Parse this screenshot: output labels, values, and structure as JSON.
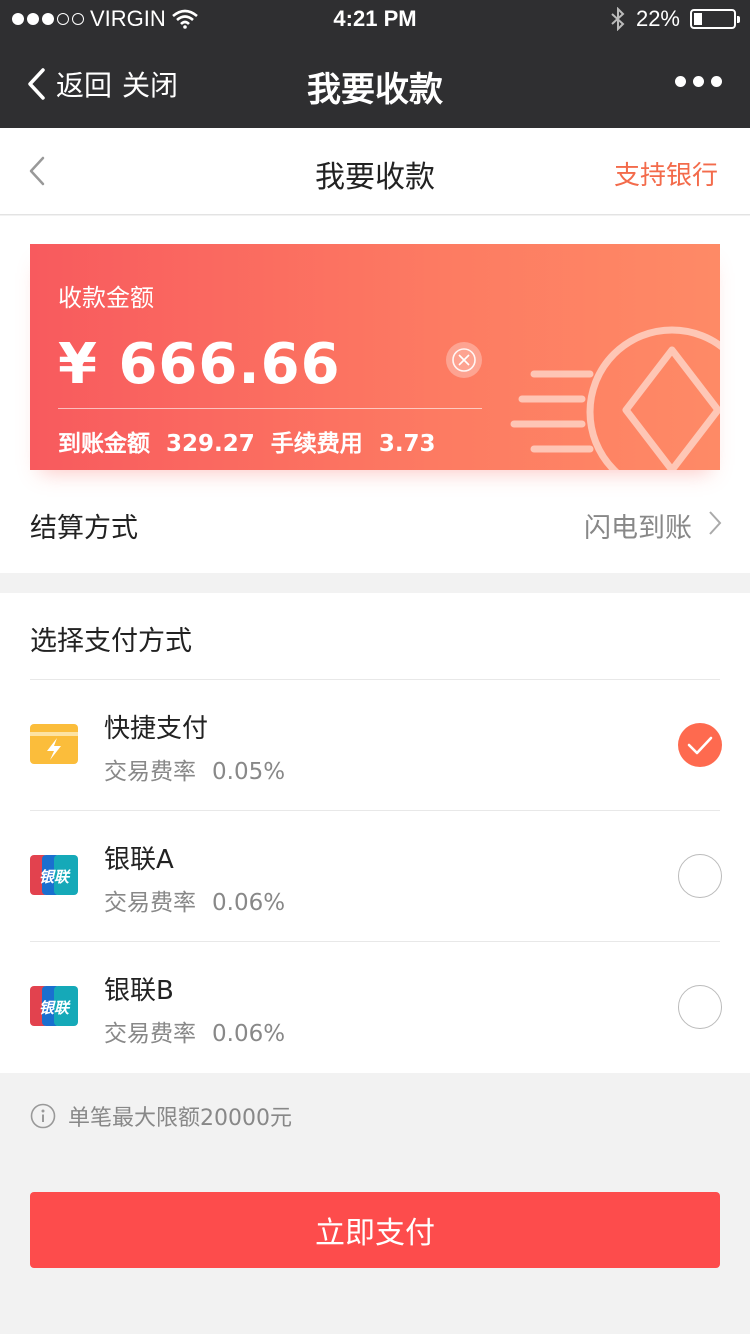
{
  "status_bar": {
    "carrier": "VIRGIN",
    "time": "4:21 PM",
    "battery": "22%"
  },
  "nav": {
    "back_label": "返回",
    "close_label": "关闭",
    "title": "我要收款"
  },
  "page_header": {
    "title": "我要收款",
    "right_link": "支持银行"
  },
  "amount_card": {
    "label": "收款金额",
    "amount": "¥ 666.66",
    "received_label": "到账金额",
    "received_value": "329.27",
    "fee_label": "手续费用",
    "fee_value": "3.73"
  },
  "settlement": {
    "label": "结算方式",
    "value": "闪电到账"
  },
  "payment": {
    "title": "选择支付方式",
    "rate_label": "交易费率",
    "methods": [
      {
        "name": "快捷支付",
        "rate": "0.05%",
        "icon": "quick-pay-card-icon",
        "selected": true
      },
      {
        "name": "银联A",
        "rate": "0.06%",
        "icon": "unionpay-icon",
        "icon_text": "银联",
        "selected": false
      },
      {
        "name": "银联B",
        "rate": "0.06%",
        "icon": "unionpay-icon",
        "icon_text": "银联",
        "selected": false
      }
    ]
  },
  "limit_note": "单笔最大限额20000元",
  "pay_button": "立即支付",
  "colors": {
    "accent": "#f36b4b",
    "button": "#fd4c4c",
    "bar": "#2f2f31"
  }
}
